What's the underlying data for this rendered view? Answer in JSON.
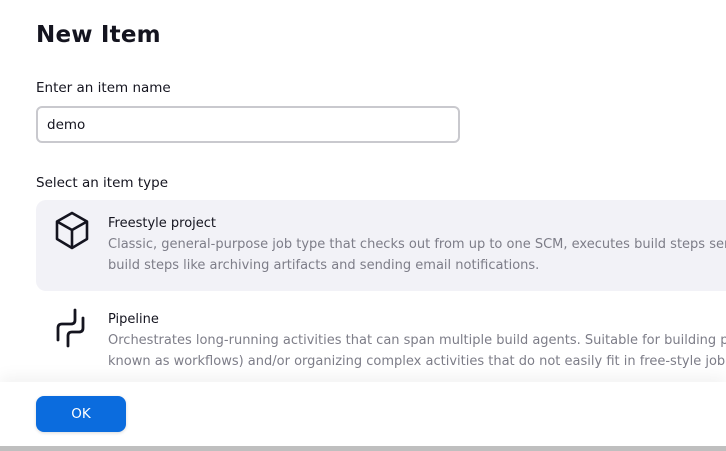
{
  "page": {
    "title": "New Item"
  },
  "name_field": {
    "label": "Enter an item name",
    "value": "demo"
  },
  "type_section": {
    "label": "Select an item type",
    "items": [
      {
        "name": "Freestyle project",
        "desc_line1": "Classic, general-purpose job type that checks out from up to one SCM, executes build steps seri",
        "desc_line2": "build steps like archiving artifacts and sending email notifications.",
        "icon": "freestyle-box-icon",
        "selected": true
      },
      {
        "name": "Pipeline",
        "desc_line1": "Orchestrates long-running activities that can span multiple build agents. Suitable for building pip",
        "desc_line2": "known as workflows) and/or organizing complex activities that do not easily fit in free-style job t",
        "icon": "pipeline-icon",
        "selected": false
      }
    ]
  },
  "footer": {
    "ok_label": "OK"
  },
  "colors": {
    "accent": "#0b6cde",
    "selected_bg": "#f2f2f7",
    "muted_text": "#7d7d88"
  }
}
